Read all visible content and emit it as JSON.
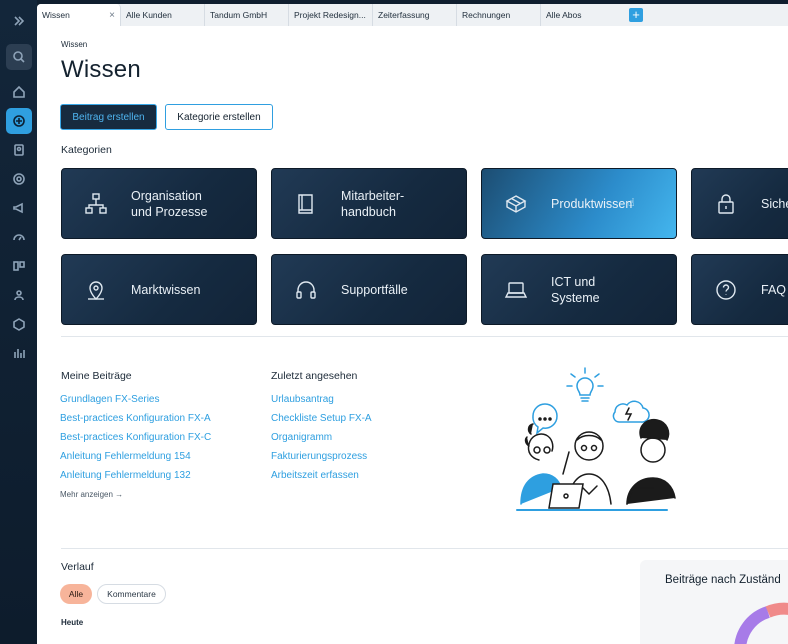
{
  "tabs": [
    {
      "label": "Wissen",
      "active": true
    },
    {
      "label": "Alle Kunden"
    },
    {
      "label": "Tandum GmbH"
    },
    {
      "label": "Projekt Redesign..."
    },
    {
      "label": "Zeiterfassung"
    },
    {
      "label": "Rechnungen"
    },
    {
      "label": "Alle Abos"
    }
  ],
  "tab_close": "×",
  "tab_add": "+",
  "breadcrumb": "Wissen",
  "page_title": "Wissen",
  "buttons": {
    "create_post": "Beitrag erstellen",
    "create_category": "Kategorie erstellen"
  },
  "categories_label": "Kategorien",
  "categories": [
    {
      "label": "Organisation\nund Prozesse",
      "icon": "hierarchy-icon"
    },
    {
      "label": "Mitarbeiter-\nhandbuch",
      "icon": "book-icon"
    },
    {
      "label": "Produktwissen",
      "icon": "box-icon",
      "highlighted": true
    },
    {
      "label": "Sicherh",
      "icon": "lock-icon"
    },
    {
      "label": "Marktwissen",
      "icon": "location-pin-icon"
    },
    {
      "label": "Supportfälle",
      "icon": "headset-icon"
    },
    {
      "label": "ICT und\nSysteme",
      "icon": "laptop-icon"
    },
    {
      "label": "FAQ",
      "icon": "question-icon"
    }
  ],
  "my_posts": {
    "title": "Meine Beiträge",
    "items": [
      "Grundlagen FX-Series",
      "Best-practices Konfiguration FX-A",
      "Best-practices Konfiguration FX-C",
      "Anleitung Fehlermeldung 154",
      "Anleitung Fehlermeldung 132"
    ],
    "more": "Mehr anzeigen →"
  },
  "recent": {
    "title": "Zuletzt angesehen",
    "items": [
      "Urlaubsantrag",
      "Checkliste Setup FX-A",
      "Organigramm",
      "Fakturierungsprozess",
      "Arbeitszeit erfassen"
    ]
  },
  "history": {
    "title": "Verlauf",
    "filters": [
      "Alle",
      "Kommentare"
    ],
    "today": "Heute"
  },
  "stats_title": "Beiträge nach Zuständ",
  "colors": {
    "accent": "#2f9fe0",
    "card_dark": "#172b40",
    "pill_active": "#f7b49a"
  }
}
